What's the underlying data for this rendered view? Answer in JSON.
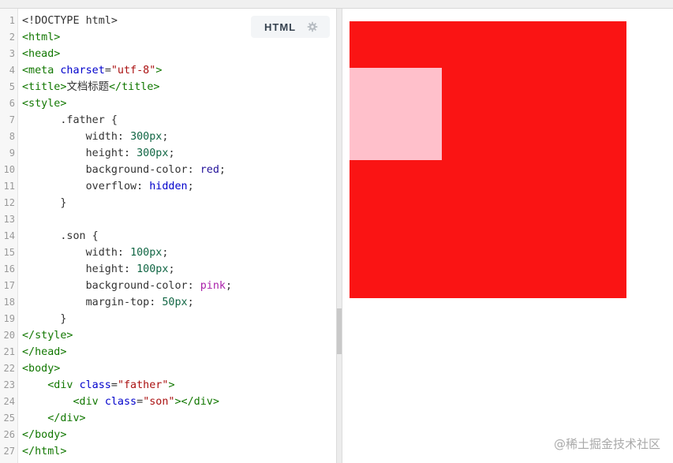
{
  "editor": {
    "language_label": "HTML",
    "settings_icon": "gear-icon",
    "lines": [
      {
        "n": "1",
        "segments": [
          {
            "t": "<!DOCTYPE html>",
            "c": "prop"
          }
        ]
      },
      {
        "n": "2",
        "segments": [
          {
            "t": "<html>",
            "c": "tag"
          }
        ]
      },
      {
        "n": "3",
        "segments": [
          {
            "t": "<head>",
            "c": "tag"
          }
        ]
      },
      {
        "n": "4",
        "segments": [
          {
            "t": "<meta ",
            "c": "tag"
          },
          {
            "t": "charset",
            "c": "attr"
          },
          {
            "t": "=",
            "c": "prop"
          },
          {
            "t": "\"utf-8\"",
            "c": "str"
          },
          {
            "t": ">",
            "c": "tag"
          }
        ]
      },
      {
        "n": "5",
        "segments": [
          {
            "t": "<title>",
            "c": "tag"
          },
          {
            "t": "文档标题",
            "c": "prop"
          },
          {
            "t": "</title>",
            "c": "tag"
          }
        ]
      },
      {
        "n": "6",
        "segments": [
          {
            "t": "<style>",
            "c": "tag"
          }
        ]
      },
      {
        "n": "7",
        "segments": [
          {
            "t": "      .father {",
            "c": "prop"
          }
        ]
      },
      {
        "n": "8",
        "segments": [
          {
            "t": "          width: ",
            "c": "prop"
          },
          {
            "t": "300px",
            "c": "num"
          },
          {
            "t": ";",
            "c": "prop"
          }
        ]
      },
      {
        "n": "9",
        "segments": [
          {
            "t": "          height: ",
            "c": "prop"
          },
          {
            "t": "300px",
            "c": "num"
          },
          {
            "t": ";",
            "c": "prop"
          }
        ]
      },
      {
        "n": "10",
        "segments": [
          {
            "t": "          background-color: ",
            "c": "prop"
          },
          {
            "t": "red",
            "c": "kw"
          },
          {
            "t": ";",
            "c": "prop"
          }
        ]
      },
      {
        "n": "11",
        "segments": [
          {
            "t": "          overflow: ",
            "c": "prop"
          },
          {
            "t": "hidden",
            "c": "attr"
          },
          {
            "t": ";",
            "c": "prop"
          }
        ]
      },
      {
        "n": "12",
        "segments": [
          {
            "t": "      }",
            "c": "prop"
          }
        ]
      },
      {
        "n": "13",
        "segments": [
          {
            "t": "",
            "c": "prop"
          }
        ]
      },
      {
        "n": "14",
        "segments": [
          {
            "t": "      .son {",
            "c": "prop"
          }
        ]
      },
      {
        "n": "15",
        "segments": [
          {
            "t": "          width: ",
            "c": "prop"
          },
          {
            "t": "100px",
            "c": "num"
          },
          {
            "t": ";",
            "c": "prop"
          }
        ]
      },
      {
        "n": "16",
        "segments": [
          {
            "t": "          height: ",
            "c": "prop"
          },
          {
            "t": "100px",
            "c": "num"
          },
          {
            "t": ";",
            "c": "prop"
          }
        ]
      },
      {
        "n": "17",
        "segments": [
          {
            "t": "          background-color: ",
            "c": "prop"
          },
          {
            "t": "pink",
            "c": "atom"
          },
          {
            "t": ";",
            "c": "prop"
          }
        ]
      },
      {
        "n": "18",
        "segments": [
          {
            "t": "          margin-top: ",
            "c": "prop"
          },
          {
            "t": "50px",
            "c": "num"
          },
          {
            "t": ";",
            "c": "prop"
          }
        ]
      },
      {
        "n": "19",
        "segments": [
          {
            "t": "      }",
            "c": "prop"
          }
        ]
      },
      {
        "n": "20",
        "segments": [
          {
            "t": "</style>",
            "c": "tag"
          }
        ]
      },
      {
        "n": "21",
        "segments": [
          {
            "t": "</head>",
            "c": "tag"
          }
        ]
      },
      {
        "n": "22",
        "segments": [
          {
            "t": "<body>",
            "c": "tag"
          }
        ]
      },
      {
        "n": "23",
        "segments": [
          {
            "t": "    <div ",
            "c": "tag"
          },
          {
            "t": "class",
            "c": "attr"
          },
          {
            "t": "=",
            "c": "prop"
          },
          {
            "t": "\"father\"",
            "c": "str"
          },
          {
            "t": ">",
            "c": "tag"
          }
        ]
      },
      {
        "n": "24",
        "segments": [
          {
            "t": "        <div ",
            "c": "tag"
          },
          {
            "t": "class",
            "c": "attr"
          },
          {
            "t": "=",
            "c": "prop"
          },
          {
            "t": "\"son\"",
            "c": "str"
          },
          {
            "t": "></div>",
            "c": "tag"
          }
        ]
      },
      {
        "n": "25",
        "segments": [
          {
            "t": "    </div>",
            "c": "tag"
          }
        ]
      },
      {
        "n": "26",
        "segments": [
          {
            "t": "</body>",
            "c": "tag"
          }
        ]
      },
      {
        "n": "27",
        "segments": [
          {
            "t": "</html>",
            "c": "tag"
          }
        ]
      }
    ]
  },
  "preview": {
    "father_color": "#fa1414",
    "son_color": "#ffc0cb"
  },
  "watermark": "@稀土掘金技术社区"
}
